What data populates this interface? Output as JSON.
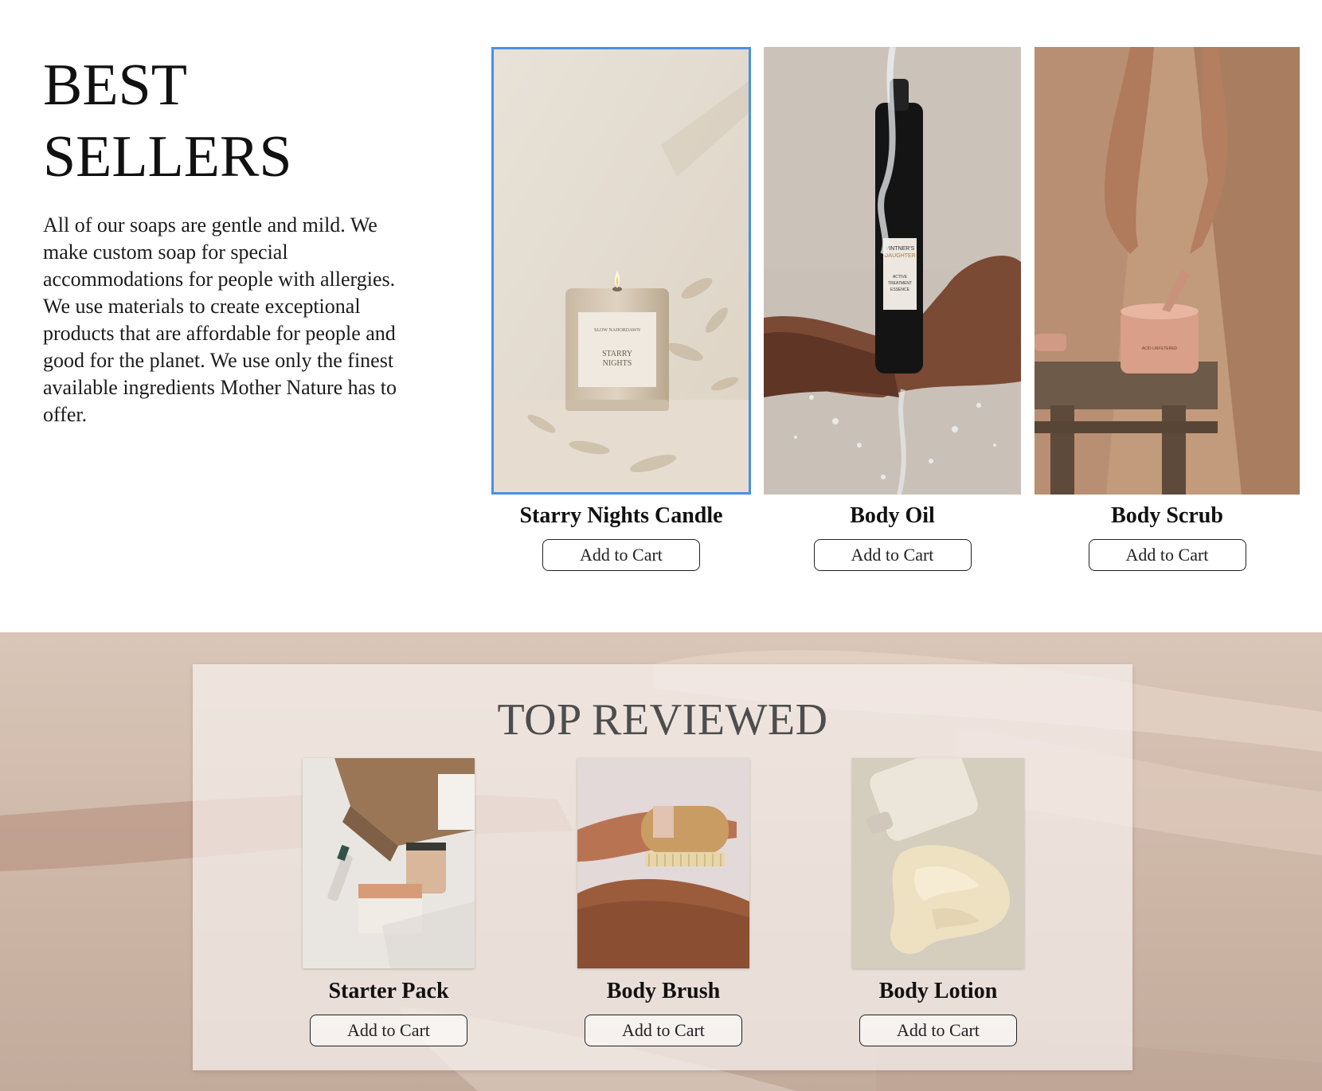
{
  "best_sellers": {
    "title_line1": "BEST",
    "title_line2": "SELLERS",
    "description": "All of our soaps are gentle and mild. We make custom soap for special accommodations for people with allergies. We use materials to create exceptional products that are affordable for people and good for the planet. We use only the finest available ingredients Mother Nature has to offer.",
    "products": [
      {
        "name": "Starry Nights Candle",
        "button": "Add to Cart",
        "label_brand": "SLOW NAHORDAWN",
        "label_line1": "STARRY",
        "label_line2": "NIGHTS"
      },
      {
        "name": "Body Oil",
        "button": "Add to Cart",
        "label_brand1": "VINTNER'S",
        "label_brand2": "DAUGHTER",
        "label_line1": "ACTIVE",
        "label_line2": "TREATMENT",
        "label_line3": "ESSENCE"
      },
      {
        "name": "Body Scrub",
        "button": "Add to Cart",
        "label_brand": "ACID UNFILTERED"
      }
    ]
  },
  "top_reviewed": {
    "title": "TOP REVIEWED",
    "products": [
      {
        "name": "Starter Pack",
        "button": "Add to Cart"
      },
      {
        "name": "Body Brush",
        "button": "Add to Cart"
      },
      {
        "name": "Body Lotion",
        "button": "Add to Cart"
      }
    ]
  },
  "colors": {
    "selection_border": "#4a90e2",
    "section_bg": "#d3beaf",
    "card_bg": "#f4eeeb"
  }
}
